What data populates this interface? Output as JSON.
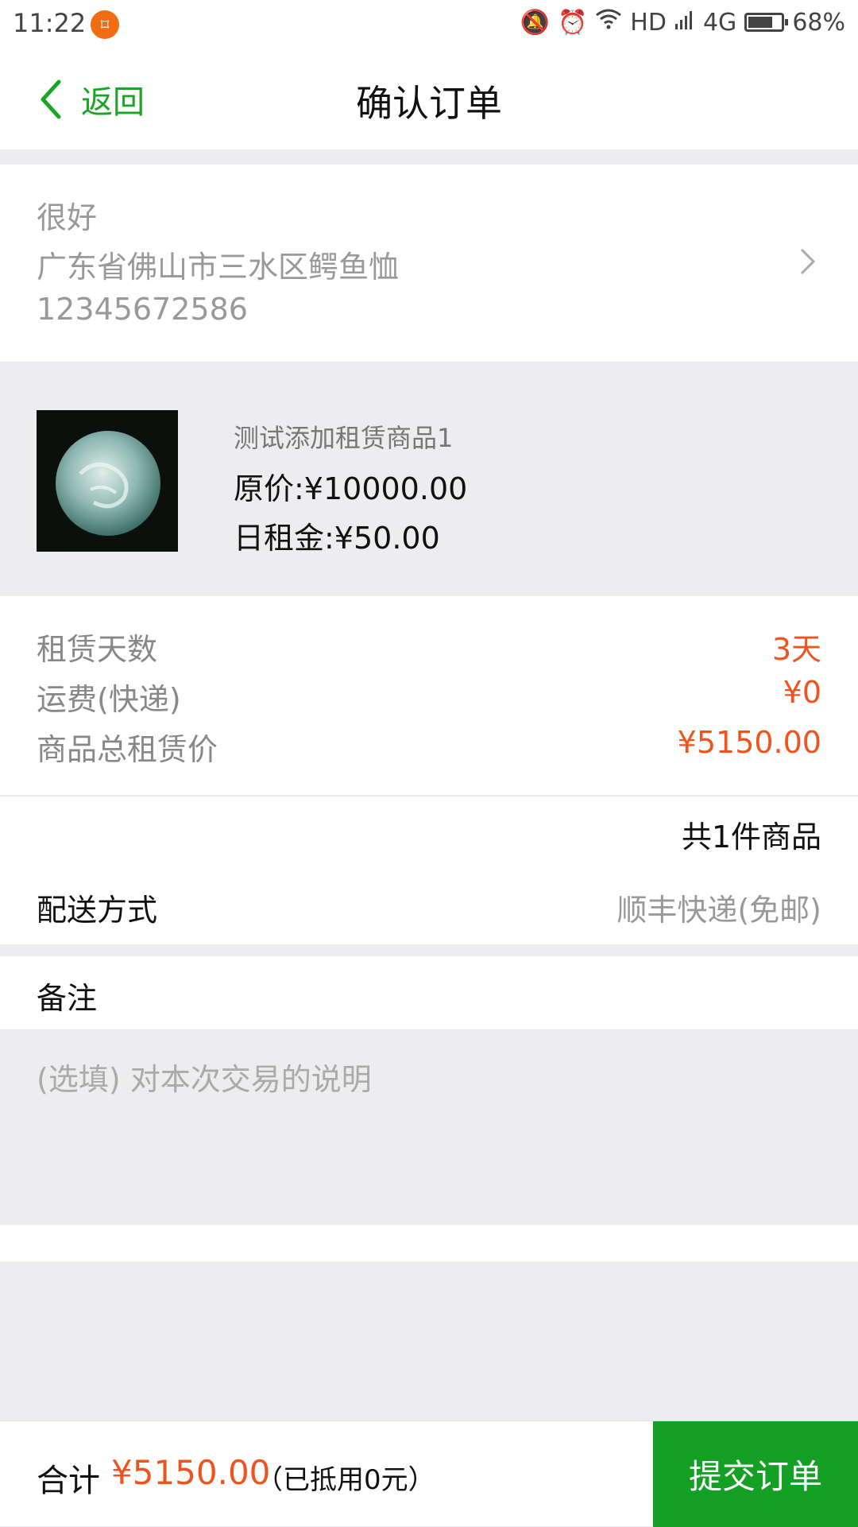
{
  "status_bar": {
    "time": "11:22",
    "network": "HD",
    "signal": "4G",
    "battery": "68%"
  },
  "nav": {
    "back_label": "返回",
    "title": "确认订单"
  },
  "address": {
    "name": "很好",
    "address": "广东省佛山市三水区鳄鱼恤",
    "phone": "12345672586"
  },
  "product": {
    "name": "测试添加租赁商品1",
    "original_price": "原价:¥10000.00",
    "daily_rent": "日租金:¥50.00"
  },
  "summary": {
    "rows": [
      {
        "label": "租赁天数",
        "value": "3天"
      },
      {
        "label": "运费(快递)",
        "value": "¥0"
      },
      {
        "label": "商品总租赁价",
        "value": "¥5150.00"
      }
    ]
  },
  "order": {
    "item_count": "共1件商品",
    "delivery_label": "配送方式",
    "delivery_value": "顺丰快递(免邮)"
  },
  "remark": {
    "label": "备注",
    "placeholder": "(选填) 对本次交易的说明"
  },
  "footer": {
    "total_label": "合计",
    "total_value": "¥5150.00",
    "deduction_note": "（已抵用0元）",
    "submit_label": "提交订单"
  },
  "colors": {
    "accent_green": "#13a024",
    "price_orange": "#f0541e",
    "background": "#ededf0"
  }
}
